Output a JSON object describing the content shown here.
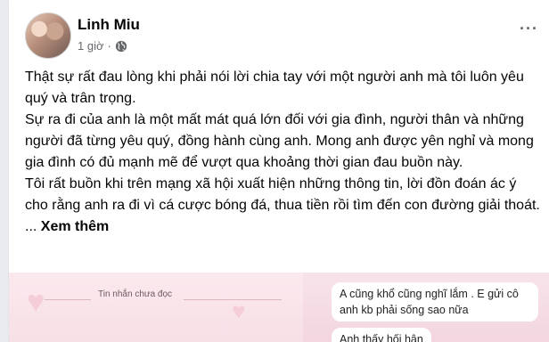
{
  "post": {
    "author": "Linh Miu",
    "time": "1 giờ",
    "separator": "·",
    "more_label": "···",
    "paragraphs": [
      "Thật sự rất đau lòng khi phải nói lời chia tay với một người anh mà tôi luôn yêu quý và trân trọng.",
      "Sự ra đi của anh là một mất mát quá lớn đối với gia đình, người thân và những người đã từng yêu quý, đồng hành cùng anh. Mong anh được yên nghỉ và mong gia đình có đủ mạnh mẽ để vượt qua khoảng thời gian đau buồn này.",
      "Tôi rất buồn khi trên mạng xã hội xuất hiện những thông tin, lời đồn đoán ác ý cho rằng anh ra đi vì cá cược bóng đá, thua tiền rồi tìm đến con đường giải thoát. ..."
    ],
    "see_more": "Xem thêm"
  },
  "photo": {
    "unread_label": "Tin nhắn chưa đọc",
    "messages": [
      "A cũng khổ cũng nghĩ lắm . E gửi cô anh kb phải sống sao nữa",
      "Anh thấy hối hận"
    ]
  },
  "icons": [
    "avatar",
    "globe-icon",
    "more-options-icon"
  ],
  "colors": {
    "text": "#050505",
    "secondary": "#65676b",
    "photo_bg": "#f6e8ec"
  }
}
